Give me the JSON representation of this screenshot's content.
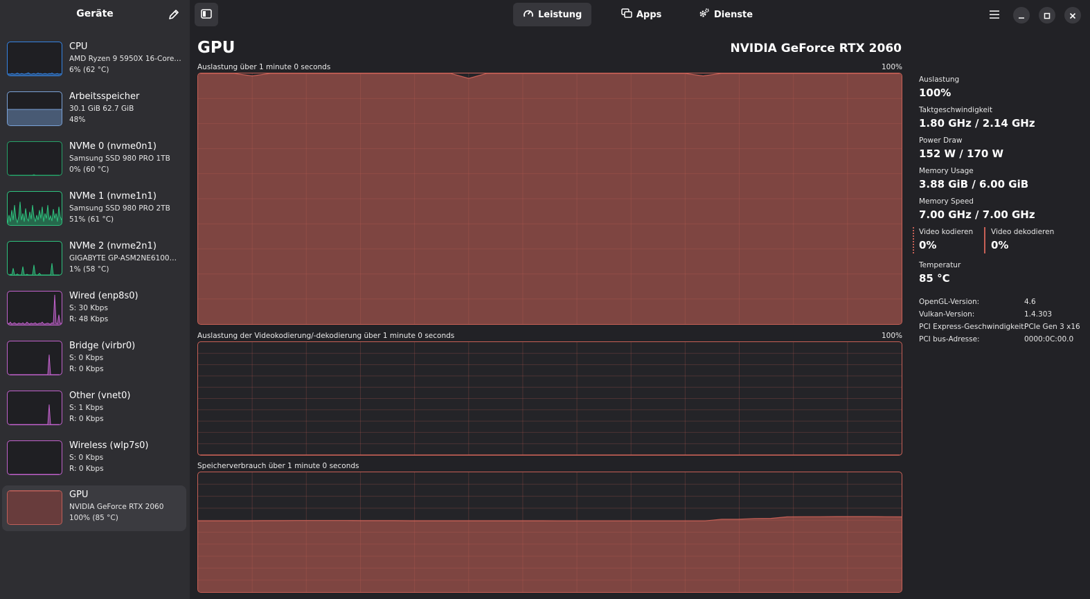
{
  "sidebar": {
    "title": "Geräte",
    "devices": [
      {
        "name": "CPU",
        "line1": "AMD Ryzen 9 5950X 16-Core…",
        "line2": "6% (62 °C)",
        "color": "#3584e4",
        "values": [
          4,
          5,
          4,
          6,
          5,
          4,
          5,
          7,
          5,
          4,
          6,
          5,
          4,
          5,
          6,
          8,
          5,
          4,
          5,
          6,
          4,
          5,
          7,
          5,
          6,
          4,
          5,
          6,
          5,
          4,
          6,
          5,
          7,
          5,
          4,
          5,
          6,
          4,
          5,
          5
        ]
      },
      {
        "name": "Arbeitsspeicher",
        "line1": "30.1 GiB 62.7 GiB",
        "line2": "48%",
        "color": "#7aa2d8",
        "values": [
          48,
          48,
          48,
          48,
          48,
          48,
          48,
          48,
          48,
          48,
          48,
          48,
          48,
          48,
          48,
          48,
          48,
          48,
          48,
          48
        ]
      },
      {
        "name": "NVMe 0 (nvme0n1)",
        "line1": "Samsung SSD 980 PRO 1TB",
        "line2": "0% (60 °C)",
        "color": "#26a269",
        "values": [
          0,
          0,
          0,
          0,
          0,
          0,
          0,
          0,
          0,
          0,
          0,
          0,
          0,
          0,
          0,
          0,
          0,
          0,
          0,
          2,
          0,
          0,
          0,
          0,
          0,
          0,
          0,
          0,
          0,
          0,
          0,
          0,
          0,
          0,
          0,
          0,
          0,
          0,
          0,
          0
        ]
      },
      {
        "name": "NVMe 1 (nvme1n1)",
        "line1": "Samsung SSD 980 PRO 2TB",
        "line2": "51% (61 °C)",
        "color": "#2ec27e",
        "values": [
          5,
          30,
          10,
          45,
          15,
          60,
          20,
          8,
          25,
          70,
          15,
          35,
          10,
          50,
          20,
          12,
          40,
          18,
          60,
          25,
          10,
          30,
          15,
          45,
          20,
          55,
          10,
          35,
          20,
          60,
          15,
          28,
          12,
          48,
          20,
          35,
          10,
          55,
          25,
          15
        ]
      },
      {
        "name": "NVMe 2 (nvme2n1)",
        "line1": "GIGABYTE GP-ASM2NE6100…",
        "line2": "1% (58 °C)",
        "color": "#2ec27e",
        "values": [
          0,
          0,
          2,
          0,
          20,
          0,
          0,
          3,
          0,
          0,
          0,
          25,
          0,
          0,
          2,
          0,
          0,
          0,
          0,
          30,
          0,
          0,
          0,
          5,
          0,
          0,
          0,
          0,
          0,
          0,
          0,
          0,
          35,
          0,
          0,
          0,
          0,
          0,
          0,
          0
        ]
      },
      {
        "name": "Wired (enp8s0)",
        "line1": "S: 30 Kbps",
        "line2": "R: 48 Kbps",
        "color": "#c061cb",
        "values": [
          5,
          3,
          8,
          2,
          4,
          6,
          3,
          2,
          5,
          4,
          3,
          6,
          2,
          3,
          8,
          4,
          2,
          5,
          3,
          4,
          6,
          2,
          3,
          5,
          4,
          8,
          3,
          2,
          4,
          5,
          3,
          2,
          6,
          4,
          90,
          5,
          3,
          30,
          4,
          5
        ]
      },
      {
        "name": "Bridge (virbr0)",
        "line1": "S: 0 Kbps",
        "line2": "R: 0 Kbps",
        "color": "#c061cb",
        "values": [
          0,
          0,
          0,
          0,
          0,
          0,
          0,
          0,
          0,
          0,
          0,
          0,
          0,
          0,
          0,
          0,
          0,
          0,
          0,
          0,
          0,
          0,
          0,
          0,
          0,
          0,
          0,
          0,
          0,
          0,
          60,
          0,
          0,
          0,
          0,
          0,
          0,
          0,
          0,
          0
        ]
      },
      {
        "name": "Other (vnet0)",
        "line1": "S: 1 Kbps",
        "line2": "R: 0 Kbps",
        "color": "#c061cb",
        "values": [
          0,
          0,
          0,
          0,
          0,
          0,
          0,
          0,
          0,
          0,
          0,
          0,
          0,
          0,
          0,
          0,
          0,
          0,
          0,
          0,
          0,
          0,
          0,
          0,
          0,
          0,
          0,
          0,
          0,
          0,
          60,
          0,
          0,
          0,
          0,
          0,
          0,
          0,
          0,
          0
        ]
      },
      {
        "name": "Wireless (wlp7s0)",
        "line1": "S: 0 Kbps",
        "line2": "R: 0 Kbps",
        "color": "#c061cb",
        "values": [
          0,
          0,
          0,
          0,
          0,
          0,
          0,
          0,
          0,
          0,
          0,
          0,
          0,
          0,
          0,
          0,
          0,
          0,
          0,
          0
        ]
      },
      {
        "name": "GPU",
        "line1": "NVIDIA GeForce RTX 2060",
        "line2": "100% (85 °C)",
        "color": "#c0605a",
        "values": [
          100,
          100,
          100,
          100,
          100,
          100,
          100,
          100,
          100,
          100,
          100,
          100,
          100,
          100,
          100,
          100,
          100,
          100,
          100,
          100
        ]
      }
    ]
  },
  "tabs": [
    {
      "label": "Leistung",
      "icon": "gauge-icon"
    },
    {
      "label": "Apps",
      "icon": "windows-icon"
    },
    {
      "label": "Dienste",
      "icon": "gears-icon"
    }
  ],
  "main": {
    "title": "GPU",
    "model": "NVIDIA GeForce RTX 2060",
    "util_graph": {
      "label": "Auslastung über 1 minute 0 seconds",
      "max": "100%"
    },
    "video_graph": {
      "label": "Auslastung der Videokodierung/-dekodierung über 1 minute 0 seconds",
      "max": "100%"
    },
    "mem_graph": {
      "label": "Speicherverbrauch über 1 minute 0 seconds"
    }
  },
  "chart_data": {
    "type": "area",
    "accent": "#c86056",
    "gpu_utilization": [
      100,
      100,
      100,
      99,
      100,
      100,
      100,
      100,
      100,
      100,
      100,
      100,
      100,
      100,
      100,
      98,
      100,
      100,
      100,
      100,
      100,
      100,
      100,
      100,
      100,
      100,
      100,
      100,
      99,
      100,
      100,
      100,
      100,
      100,
      100,
      100,
      100,
      100,
      100,
      100
    ],
    "video_encode": [
      0,
      0,
      0,
      0,
      0,
      0,
      0,
      0,
      0,
      0,
      0,
      0,
      0,
      0,
      0,
      0,
      0,
      0,
      0,
      0
    ],
    "memory_usage_percent": [
      59.5,
      59.5,
      59.5,
      59.5,
      59.6,
      59.6,
      59.7,
      59.7,
      59.7,
      59.7,
      59.6,
      59.6,
      59.6,
      59.5,
      59.5,
      59.5,
      59.5,
      59.5,
      59.5,
      59.5,
      59.5,
      59.5,
      59.4,
      59.4,
      59.4,
      59.4,
      59.4,
      59.4,
      59.4,
      59.4,
      59.4,
      59.4,
      60.8,
      60.8,
      61.4,
      61.5,
      62.8,
      62.9,
      62.9,
      63.0,
      63.0,
      63.0,
      62.9,
      62.8
    ]
  },
  "stats": [
    {
      "label": "Auslastung",
      "value": "100%"
    },
    {
      "label": "Taktgeschwindigkeit",
      "value": "1.80 GHz / 2.14 GHz"
    },
    {
      "label": "Power Draw",
      "value": "152 W / 170 W"
    },
    {
      "label": "Memory Usage",
      "value": "3.88 GiB / 6.00 GiB"
    },
    {
      "label": "Memory Speed",
      "value": "7.00 GHz / 7.00 GHz"
    }
  ],
  "video": {
    "encode_label": "Video kodieren",
    "encode_value": "0%",
    "decode_label": "Video dekodieren",
    "decode_value": "0%"
  },
  "temperature": {
    "label": "Temperatur",
    "value": "85 °C"
  },
  "info": [
    {
      "key": "OpenGL-Version:",
      "value": "4.6"
    },
    {
      "key": "Vulkan-Version:",
      "value": "1.4.303"
    },
    {
      "key": "PCI Express-Geschwindigkeit:",
      "value": "PCIe Gen 3 x16"
    },
    {
      "key": "PCI bus-Adresse:",
      "value": "0000:0C:00.0"
    }
  ]
}
